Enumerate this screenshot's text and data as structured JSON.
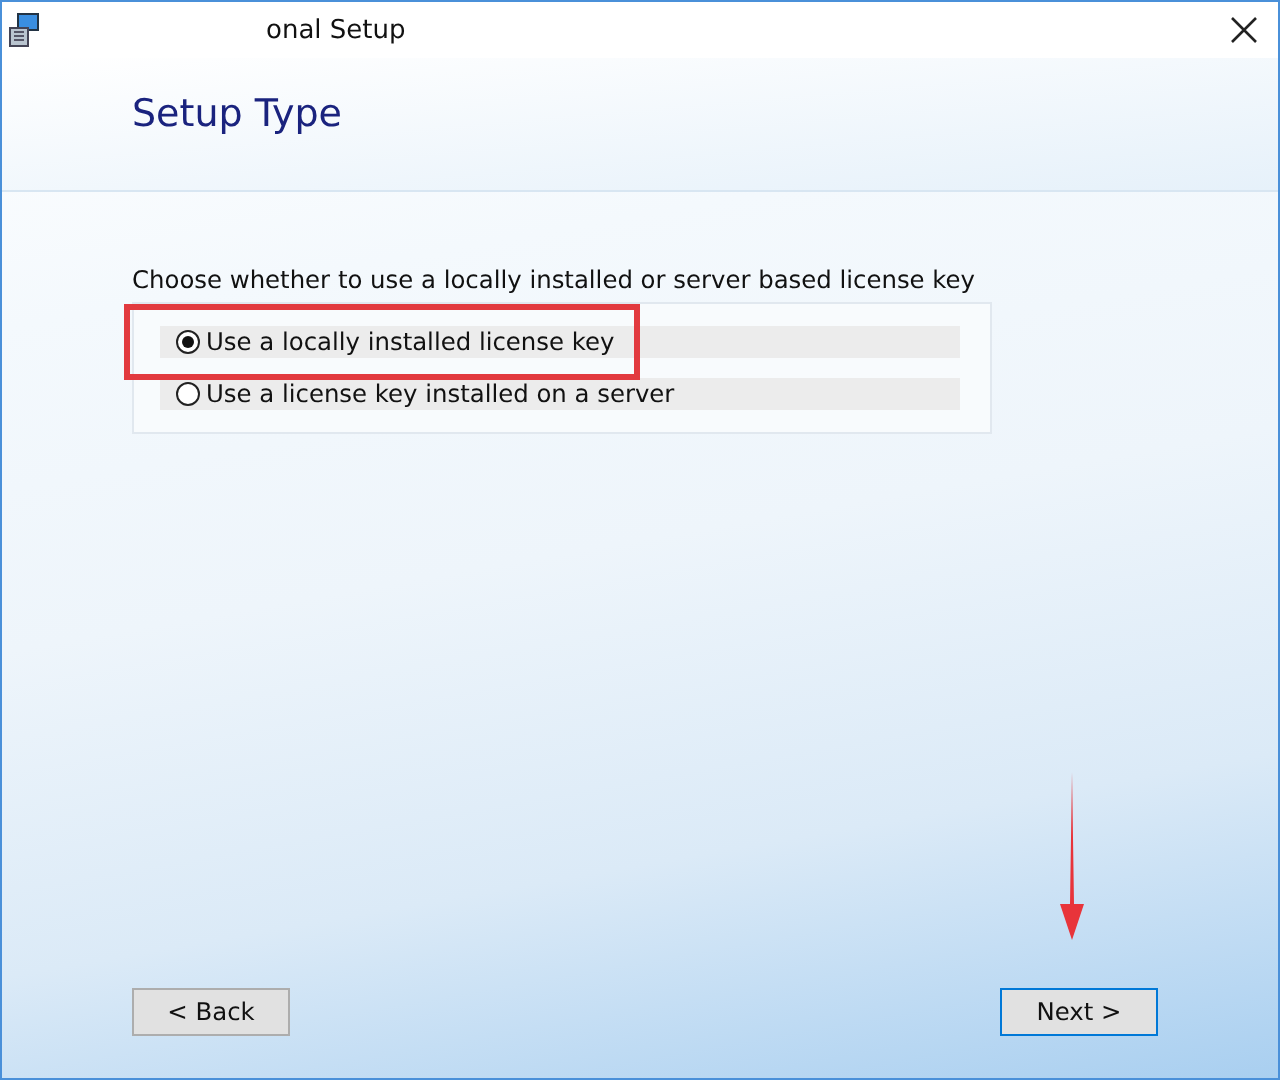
{
  "window": {
    "title": "onal Setup"
  },
  "header": {
    "title": "Setup Type"
  },
  "prompt": "Choose whether to use a locally installed or server based license key",
  "options": [
    {
      "label": "Use a locally installed license key",
      "selected": true
    },
    {
      "label": "Use a license key installed on a server",
      "selected": false
    }
  ],
  "buttons": [
    {
      "label": "< Back",
      "default": false
    },
    {
      "label": "Next >",
      "default": true
    }
  ]
}
